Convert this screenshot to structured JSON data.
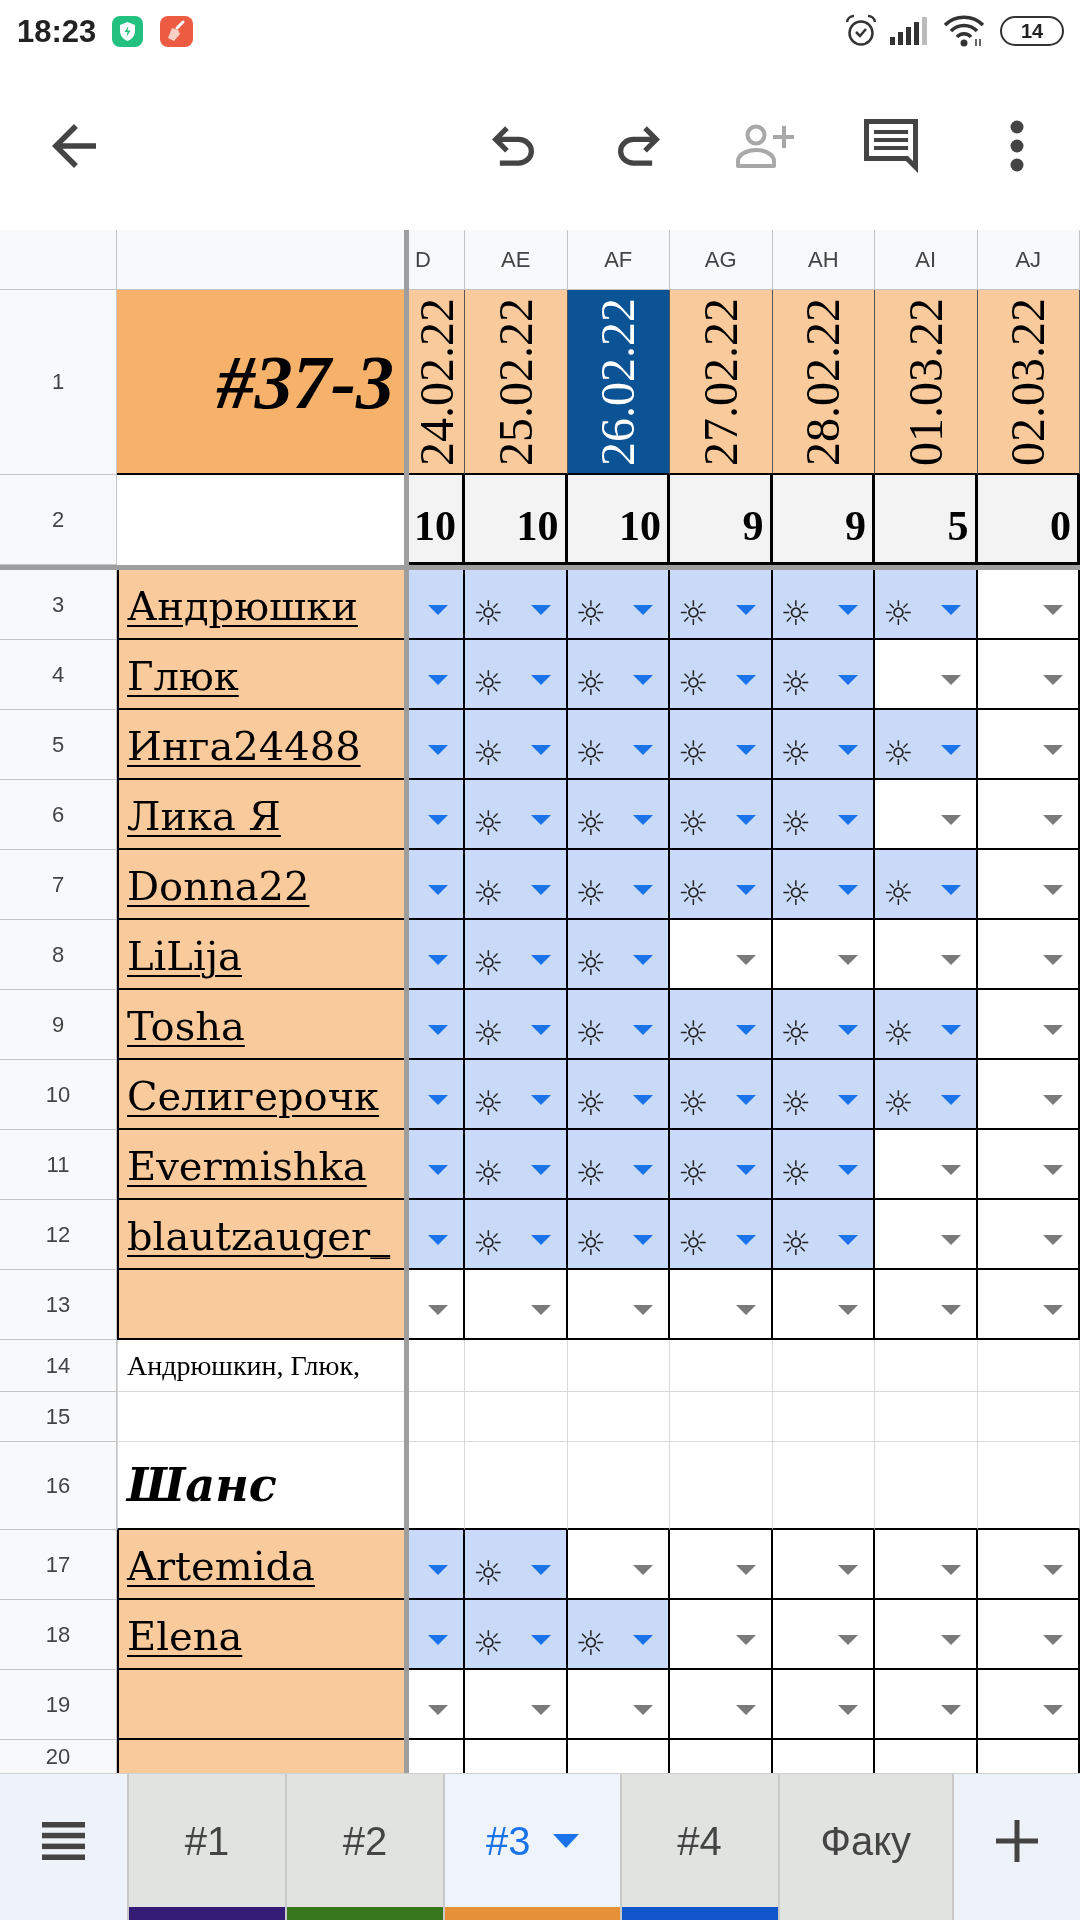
{
  "status_bar": {
    "time": "18:23",
    "battery": "14"
  },
  "toolbar": {
    "actions": [
      {
        "kind": "undo",
        "disabled": false
      },
      {
        "kind": "redo",
        "disabled": false
      },
      {
        "kind": "add_person",
        "disabled": true
      },
      {
        "kind": "comments",
        "disabled": false
      },
      {
        "kind": "more",
        "disabled": false
      }
    ]
  },
  "sheet": {
    "title_row_number": "1",
    "title": "#37-3",
    "totals_row_number": "2",
    "columns": [
      {
        "letter": "D",
        "date": "24.02.22",
        "highlighted": false,
        "total": "10"
      },
      {
        "letter": "AE",
        "date": "25.02.22",
        "highlighted": false,
        "total": "10"
      },
      {
        "letter": "AF",
        "date": "26.02.22",
        "highlighted": true,
        "total": "10"
      },
      {
        "letter": "AG",
        "date": "27.02.22",
        "highlighted": false,
        "total": "9"
      },
      {
        "letter": "AH",
        "date": "28.02.22",
        "highlighted": false,
        "total": "9"
      },
      {
        "letter": "AI",
        "date": "01.03.22",
        "highlighted": false,
        "total": "5"
      },
      {
        "letter": "AJ",
        "date": "02.03.22",
        "highlighted": false,
        "total": "0"
      }
    ],
    "rows": [
      {
        "number": "3",
        "kind": "player",
        "name": "Андрюшки",
        "cells": [
          {
            "filled": true
          },
          {
            "filled": true,
            "value": "☼"
          },
          {
            "filled": true,
            "value": "☼"
          },
          {
            "filled": true,
            "value": "☼"
          },
          {
            "filled": true,
            "value": "☼"
          },
          {
            "filled": true,
            "value": "☼"
          },
          {
            "filled": false
          }
        ]
      },
      {
        "number": "4",
        "kind": "player",
        "name": "Глюк",
        "cells": [
          {
            "filled": true
          },
          {
            "filled": true,
            "value": "☼"
          },
          {
            "filled": true,
            "value": "☼"
          },
          {
            "filled": true,
            "value": "☼"
          },
          {
            "filled": true,
            "value": "☼"
          },
          {
            "filled": false
          },
          {
            "filled": false
          }
        ]
      },
      {
        "number": "5",
        "kind": "player",
        "name": "Инга24488",
        "cells": [
          {
            "filled": true
          },
          {
            "filled": true,
            "value": "☼"
          },
          {
            "filled": true,
            "value": "☼"
          },
          {
            "filled": true,
            "value": "☼"
          },
          {
            "filled": true,
            "value": "☼"
          },
          {
            "filled": true,
            "value": "☼"
          },
          {
            "filled": false
          }
        ]
      },
      {
        "number": "6",
        "kind": "player",
        "name": "Лика Я",
        "cells": [
          {
            "filled": true
          },
          {
            "filled": true,
            "value": "☼"
          },
          {
            "filled": true,
            "value": "☼"
          },
          {
            "filled": true,
            "value": "☼"
          },
          {
            "filled": true,
            "value": "☼"
          },
          {
            "filled": false
          },
          {
            "filled": false
          }
        ]
      },
      {
        "number": "7",
        "kind": "player",
        "name": "Donna22",
        "cells": [
          {
            "filled": true
          },
          {
            "filled": true,
            "value": "☼"
          },
          {
            "filled": true,
            "value": "☼"
          },
          {
            "filled": true,
            "value": "☼"
          },
          {
            "filled": true,
            "value": "☼"
          },
          {
            "filled": true,
            "value": "☼"
          },
          {
            "filled": false
          }
        ]
      },
      {
        "number": "8",
        "kind": "player",
        "name": "LiLija",
        "cells": [
          {
            "filled": true
          },
          {
            "filled": true,
            "value": "☼"
          },
          {
            "filled": true,
            "value": "☼"
          },
          {
            "filled": false
          },
          {
            "filled": false
          },
          {
            "filled": false
          },
          {
            "filled": false
          }
        ]
      },
      {
        "number": "9",
        "kind": "player",
        "name": "Tosha",
        "cells": [
          {
            "filled": true
          },
          {
            "filled": true,
            "value": "☼"
          },
          {
            "filled": true,
            "value": "☼"
          },
          {
            "filled": true,
            "value": "☼"
          },
          {
            "filled": true,
            "value": "☼"
          },
          {
            "filled": true,
            "value": "☼"
          },
          {
            "filled": false
          }
        ]
      },
      {
        "number": "10",
        "kind": "player",
        "name": "Селигерочк",
        "cells": [
          {
            "filled": true
          },
          {
            "filled": true,
            "value": "☼"
          },
          {
            "filled": true,
            "value": "☼"
          },
          {
            "filled": true,
            "value": "☼"
          },
          {
            "filled": true,
            "value": "☼"
          },
          {
            "filled": true,
            "value": "☼"
          },
          {
            "filled": false
          }
        ]
      },
      {
        "number": "11",
        "kind": "player",
        "name": "Evermishka",
        "cells": [
          {
            "filled": true
          },
          {
            "filled": true,
            "value": "☼"
          },
          {
            "filled": true,
            "value": "☼"
          },
          {
            "filled": true,
            "value": "☼"
          },
          {
            "filled": true,
            "value": "☼"
          },
          {
            "filled": false
          },
          {
            "filled": false
          }
        ]
      },
      {
        "number": "12",
        "kind": "player",
        "name": "blautzauger_",
        "cells": [
          {
            "filled": true
          },
          {
            "filled": true,
            "value": "☼"
          },
          {
            "filled": true,
            "value": "☼"
          },
          {
            "filled": true,
            "value": "☼"
          },
          {
            "filled": true,
            "value": "☼"
          },
          {
            "filled": false
          },
          {
            "filled": false
          }
        ]
      },
      {
        "number": "13",
        "kind": "player",
        "cells": [
          {
            "filled": false
          },
          {
            "filled": false
          },
          {
            "filled": false
          },
          {
            "filled": false
          },
          {
            "filled": false
          },
          {
            "filled": false
          },
          {
            "filled": false
          }
        ]
      },
      {
        "number": "14",
        "kind": "note",
        "text": "Андрюшкин, Глюк,"
      },
      {
        "number": "15",
        "kind": "blank"
      },
      {
        "number": "16",
        "kind": "heading",
        "text": "Шанс"
      },
      {
        "number": "17",
        "kind": "player",
        "name": "Artemida",
        "cells": [
          {
            "filled": true
          },
          {
            "filled": true,
            "value": "☼"
          },
          {
            "filled": false
          },
          {
            "filled": false
          },
          {
            "filled": false
          },
          {
            "filled": false
          },
          {
            "filled": false
          }
        ]
      },
      {
        "number": "18",
        "kind": "player",
        "name": "Elena",
        "cells": [
          {
            "filled": true
          },
          {
            "filled": true,
            "value": "☼"
          },
          {
            "filled": true,
            "value": "☼"
          },
          {
            "filled": false
          },
          {
            "filled": false
          },
          {
            "filled": false
          },
          {
            "filled": false
          }
        ]
      },
      {
        "number": "19",
        "kind": "player",
        "cells": [
          {
            "filled": false
          },
          {
            "filled": false
          },
          {
            "filled": false
          },
          {
            "filled": false
          },
          {
            "filled": false
          },
          {
            "filled": false
          },
          {
            "filled": false
          }
        ]
      },
      {
        "number": "20",
        "kind": "player"
      }
    ]
  },
  "sheet_tabs": [
    {
      "label": "#1",
      "selected": false,
      "color": "#351c75"
    },
    {
      "label": "#2",
      "selected": false,
      "color": "#38761d"
    },
    {
      "label": "#3",
      "selected": true,
      "color": "#e69138"
    },
    {
      "label": "#4",
      "selected": false,
      "color": "#1155cc"
    },
    {
      "label": "Факу",
      "selected": false
    }
  ]
}
